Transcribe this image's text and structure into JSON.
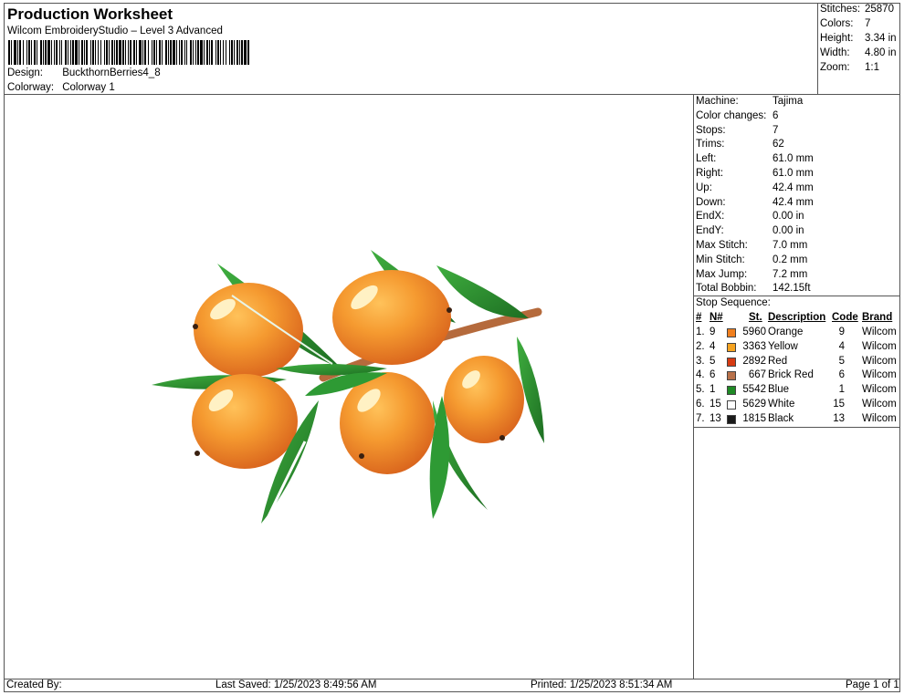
{
  "header": {
    "title": "Production Worksheet",
    "subtitle": "Wilcom EmbroideryStudio – Level 3 Advanced",
    "design_label": "Design:",
    "design_value": "BuckthornBerries4_8",
    "colorway_label": "Colorway:",
    "colorway_value": "Colorway 1"
  },
  "summary": {
    "stitches_label": "Stitches:",
    "stitches": "25870",
    "colors_label": "Colors:",
    "colors": "7",
    "height_label": "Height:",
    "height": "3.34 in",
    "width_label": "Width:",
    "width": "4.80 in",
    "zoom_label": "Zoom:",
    "zoom": "1:1"
  },
  "stats": [
    {
      "label": "Machine:",
      "value": "Tajima"
    },
    {
      "label": "Color changes:",
      "value": "6"
    },
    {
      "label": "Stops:",
      "value": "7"
    },
    {
      "label": "Trims:",
      "value": "62"
    },
    {
      "label": "Left:",
      "value": "61.0 mm"
    },
    {
      "label": "Right:",
      "value": "61.0 mm"
    },
    {
      "label": "Up:",
      "value": "42.4 mm"
    },
    {
      "label": "Down:",
      "value": "42.4 mm"
    },
    {
      "label": "EndX:",
      "value": "0.00 in"
    },
    {
      "label": "EndY:",
      "value": "0.00 in"
    },
    {
      "label": "Max Stitch:",
      "value": "7.0 mm"
    },
    {
      "label": "Min Stitch:",
      "value": "0.2 mm"
    },
    {
      "label": "Max Jump:",
      "value": "7.2 mm"
    },
    {
      "label": "Total Bobbin:",
      "value": "142.15ft"
    }
  ],
  "stop_sequence": {
    "title": "Stop Sequence:",
    "headers": {
      "num": "#",
      "n": "N#",
      "st": "St.",
      "desc": "Description",
      "code": "Code",
      "brand": "Brand"
    },
    "rows": [
      {
        "num": "1.",
        "n": "9",
        "color": "#f07f1e",
        "st": "5960",
        "desc": "Orange",
        "code": "9",
        "brand": "Wilcom"
      },
      {
        "num": "2.",
        "n": "4",
        "color": "#f5a320",
        "st": "3363",
        "desc": "Yellow",
        "code": "4",
        "brand": "Wilcom"
      },
      {
        "num": "3.",
        "n": "5",
        "color": "#d63a12",
        "st": "2892",
        "desc": "Red",
        "code": "5",
        "brand": "Wilcom"
      },
      {
        "num": "4.",
        "n": "6",
        "color": "#b8714a",
        "st": "667",
        "desc": "Brick Red",
        "code": "6",
        "brand": "Wilcom"
      },
      {
        "num": "5.",
        "n": "1",
        "color": "#1f8a25",
        "st": "5542",
        "desc": "Blue",
        "code": "1",
        "brand": "Wilcom"
      },
      {
        "num": "6.",
        "n": "15",
        "color": "#ffffff",
        "st": "5629",
        "desc": "White",
        "code": "15",
        "brand": "Wilcom"
      },
      {
        "num": "7.",
        "n": "13",
        "color": "#1a1a1a",
        "st": "1815",
        "desc": "Black",
        "code": "13",
        "brand": "Wilcom"
      }
    ]
  },
  "footer": {
    "created_by": "Created By:",
    "last_saved": "Last Saved: 1/25/2023 8:49:56 AM",
    "printed": "Printed: 1/25/2023 8:51:34 AM",
    "page": "Page 1 of 1"
  },
  "design_image": {
    "subject": "embroidered buckthorn berries branch",
    "colors": {
      "berry": "#f08a2a",
      "berry_dark": "#d9621a",
      "highlight": "#ffe39a",
      "leaf": "#2e9a34",
      "leaf_dark": "#1d6e22",
      "stem": "#b56a3c"
    }
  }
}
